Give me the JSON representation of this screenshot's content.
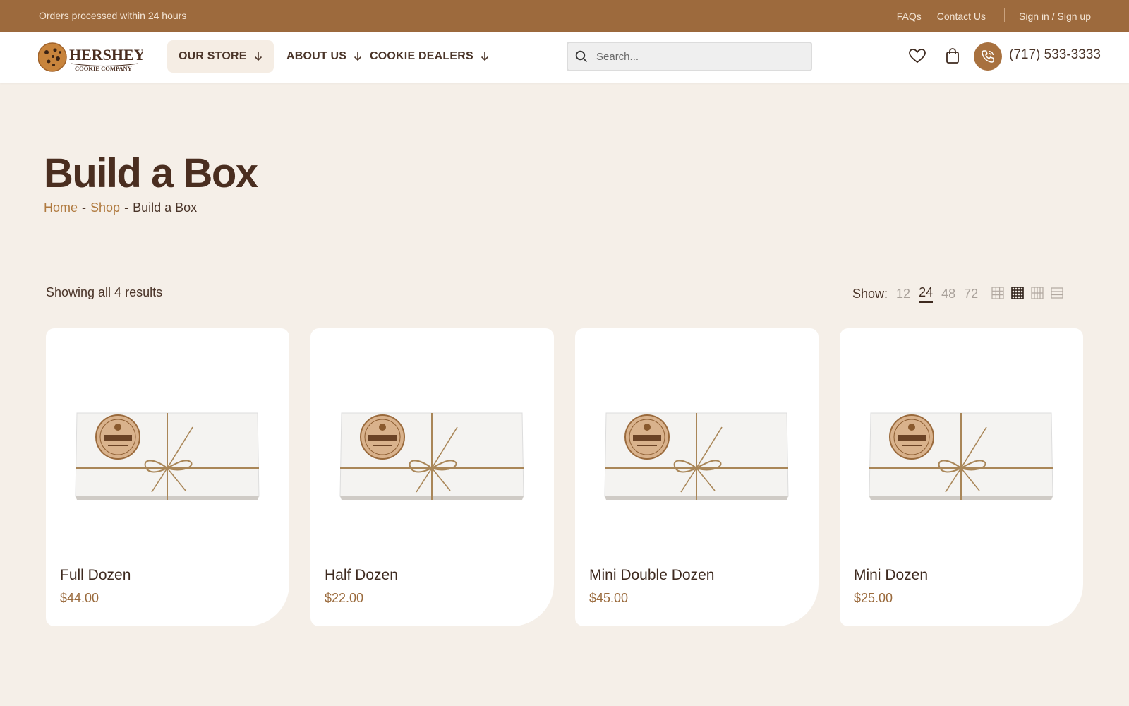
{
  "topbar": {
    "notice": "Orders processed within 24 hours",
    "faqs": "FAQs",
    "contact": "Contact Us",
    "signin": "Sign in / Sign up"
  },
  "header": {
    "logo_brand": "HERSHEY",
    "logo_sub": "COOKIE COMPANY",
    "nav": [
      {
        "label": "OUR STORE"
      },
      {
        "label": "ABOUT US"
      },
      {
        "label": "COOKIE DEALERS"
      }
    ],
    "search_placeholder": "Search...",
    "phone": "(717) 533-3333"
  },
  "page": {
    "title": "Build a Box",
    "breadcrumb": {
      "home": "Home",
      "shop": "Shop",
      "current": "Build a Box",
      "separator": "-"
    }
  },
  "toolbar": {
    "results": "Showing all 4 results",
    "show_label": "Show:",
    "show_options": [
      "12",
      "24",
      "48",
      "72"
    ],
    "show_selected": "24"
  },
  "products": [
    {
      "name": "Full Dozen",
      "price": "$44.00"
    },
    {
      "name": "Half Dozen",
      "price": "$22.00"
    },
    {
      "name": "Mini Double Dozen",
      "price": "$45.00"
    },
    {
      "name": "Mini Dozen",
      "price": "$25.00"
    }
  ],
  "colors": {
    "topbar": "#9d6a3d",
    "accent": "#a8713f",
    "background": "#f5efe8",
    "title": "#4a2e20"
  }
}
